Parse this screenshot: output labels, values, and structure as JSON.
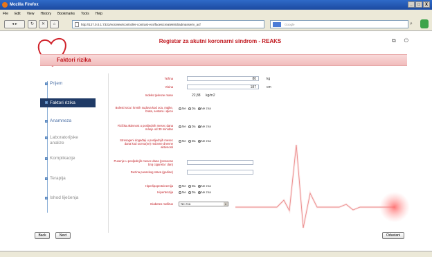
{
  "browser": {
    "window_title": "Mozilla Firefox",
    "window_buttons": [
      "_",
      "□",
      "X"
    ],
    "menu": [
      "File",
      "Edit",
      "View",
      "History",
      "Bookmarks",
      "Tools",
      "Help"
    ],
    "url": "http://127.0.0.1:7331/ecs/view/controller-contrast-ecs/facesicreateleticliadmasseriv_acf",
    "search_placeholder": "Google"
  },
  "header": {
    "app_title": "Registar za akutni koronarni sindrom - REAKS",
    "section_title": "Faktori rizika"
  },
  "sidebar": {
    "items": [
      {
        "label": "Prijem"
      },
      {
        "label": "Faktori rizika"
      },
      {
        "label": "Anamneza"
      },
      {
        "label": "Laboratorijske analize"
      },
      {
        "label": "Komplikacije"
      },
      {
        "label": "Terapija"
      },
      {
        "label": "Ishod liječenja"
      }
    ]
  },
  "form": {
    "tezina": {
      "label": "Težina",
      "value": "80",
      "unit": "kg"
    },
    "visina": {
      "label": "Visina",
      "value": "187",
      "unit": "cm"
    },
    "bmi": {
      "label": "Indeks tjelesne mase",
      "value": "22,88",
      "unit": "kg/m2"
    },
    "q1": {
      "label": "Bolesti srca i krvnih sudova kod oca, majke, brata, sestara i djece"
    },
    "q2": {
      "label": "Fizička aktivnost u posljednih mesec dana manje od 30 min/dan"
    },
    "q3": {
      "label": "Stresogeni događaji u posljednjih mesec dana kod ocena(ne) redovne dnevne aktivnosti"
    },
    "pusenje": {
      "label": "Pusenje u posljednjih mesec dana (prosecan broj cigareta / dan)"
    },
    "duzina": {
      "label": "Duzina pusackog stava (godine)"
    },
    "hiperlipo": {
      "label": "Hiperlipoproteinemija"
    },
    "hipertenzija": {
      "label": "Hipertenzija"
    },
    "diabetes": {
      "label": "Diabetes mellitus",
      "value": "Ne zna"
    },
    "radio_options": [
      "Ne",
      "Da",
      "Ne zna"
    ]
  },
  "footer": {
    "back_label": "Back",
    "next_label": "Next",
    "cancel_label": "Odustani"
  }
}
